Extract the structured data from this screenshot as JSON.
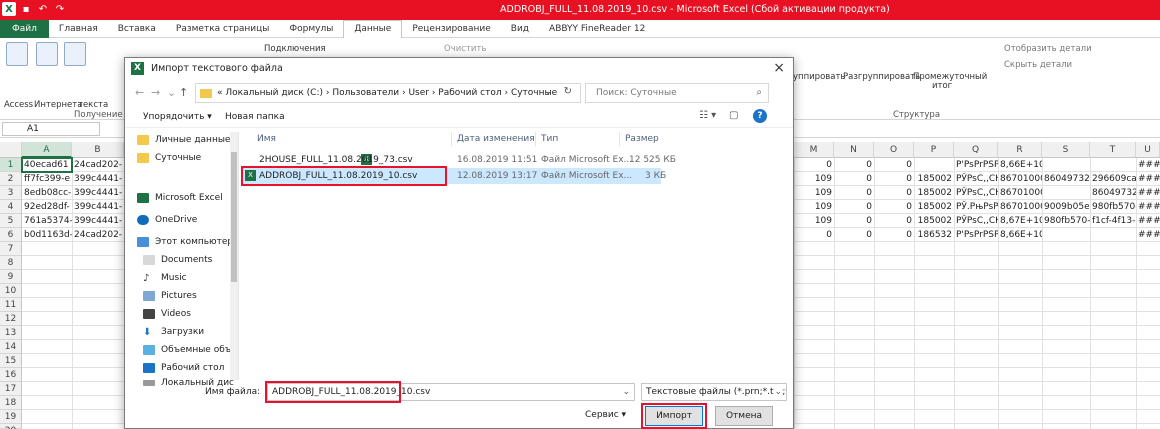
{
  "window": {
    "title": "ADDROBJ_FULL_11.08.2019_10.csv  -  Microsoft Excel (Сбой активации продукта)"
  },
  "ribbon": {
    "tabs": [
      {
        "label": "Файл"
      },
      {
        "label": "Главная"
      },
      {
        "label": "Вставка"
      },
      {
        "label": "Разметка страницы"
      },
      {
        "label": "Формулы"
      },
      {
        "label": "Данные"
      },
      {
        "label": "Рецензирование"
      },
      {
        "label": "Вид"
      },
      {
        "label": "ABBYY FineReader 12"
      }
    ],
    "connections_label": "Подключения",
    "clear_label": "Очистить",
    "access_label": "Access",
    "internet_label": "Интернета",
    "text_label": "текста",
    "get_external_label": "Получение вне",
    "group_label": "уппировать",
    "ungroup_label": "Разгруппировать",
    "subtotal_label": "Промежуточный",
    "subtotal_label2": "итог",
    "show_detail_label": "Отобразить детали",
    "hide_detail_label": "Скрыть детали",
    "structure_label": "Структура"
  },
  "namebox": {
    "value": "A1"
  },
  "grid": {
    "columns": [
      "A",
      "B",
      "M",
      "N",
      "O",
      "P",
      "Q",
      "R",
      "S",
      "T",
      "U"
    ],
    "rows": [
      "1",
      "2",
      "3",
      "4",
      "5",
      "6",
      "7",
      "8",
      "9",
      "10",
      "11",
      "12",
      "13",
      "14",
      "15",
      "16",
      "17",
      "18",
      "19",
      "20"
    ],
    "left_cells": [
      [
        "40ecad61",
        "24cad202- P'"
      ],
      [
        "ff7fc399-e",
        "399c4441- P"
      ],
      [
        "8edb08cc-",
        "399c4441- P"
      ],
      [
        "92ed28df-",
        "399c4441- P"
      ],
      [
        "761a5374-",
        "399c4441- P"
      ],
      [
        "b0d1163d-",
        "24cad202- P'"
      ]
    ],
    "right_cells": [
      [
        "0",
        "0",
        "0",
        "",
        "P'PsPrPSP",
        "8,66E+10",
        "",
        "",
        "#####"
      ],
      [
        "109",
        "0",
        "0",
        "185002",
        "PЎPsC,,CH",
        "86701000",
        "86049732-",
        "296609ca-",
        "#####"
      ],
      [
        "109",
        "0",
        "0",
        "185002",
        "PЎPsC,,CH",
        "86701000",
        "",
        "86049732-",
        "#####"
      ],
      [
        "109",
        "0",
        "0",
        "185002",
        "PЎ.PњPsP",
        "86701000",
        "9009b05e-",
        "980fb570-",
        "#####"
      ],
      [
        "109",
        "0",
        "0",
        "185002",
        "PЎPsC,,CH",
        "8,67E+10",
        "980fb570-",
        "f1cf-4f13-",
        "#####"
      ],
      [
        "0",
        "0",
        "0",
        "186532",
        "P'PsPrPSP",
        "8,66E+10",
        "",
        "",
        "#####"
      ]
    ]
  },
  "dialog": {
    "title": "Импорт текстового файла",
    "address_path": "«  Локальный диск (C:)  ›  Пользователи  ›  User  ›  Рабочий стол  ›  Суточные",
    "search_placeholder": "Поиск: Суточные",
    "organize_label": "Упорядочить ▾",
    "new_folder_label": "Новая папка",
    "nav_items": [
      {
        "label": "Личные данные",
        "icon": "folder-icon"
      },
      {
        "label": "Суточные",
        "icon": "folder-icon"
      },
      {
        "label": "Microsoft Excel",
        "icon": "excel-icon"
      },
      {
        "label": "OneDrive",
        "icon": "cloud-icon"
      },
      {
        "label": "Этот компьютер",
        "icon": "computer-icon"
      },
      {
        "label": "Documents",
        "icon": "documents-icon"
      },
      {
        "label": "Music",
        "icon": "music-icon"
      },
      {
        "label": "Pictures",
        "icon": "pictures-icon"
      },
      {
        "label": "Videos",
        "icon": "videos-icon"
      },
      {
        "label": "Загрузки",
        "icon": "downloads-icon"
      },
      {
        "label": "Объемные объ",
        "icon": "3d-objects-icon"
      },
      {
        "label": "Рабочий стол",
        "icon": "desktop-icon"
      },
      {
        "label": "Локальный дис",
        "icon": "drive-icon"
      }
    ],
    "columns": [
      "Имя",
      "Дата изменения",
      "Тип",
      "Размер"
    ],
    "files": [
      {
        "name": "2HOUSE_FULL_11.08.2019_73.csv",
        "date": "16.08.2019 11:51",
        "type": "Файл Microsoft Ex...",
        "size": "12 525 КБ",
        "selected": false
      },
      {
        "name": "ADDROBJ_FULL_11.08.2019_10.csv",
        "date": "12.08.2019 13:17",
        "type": "Файл Microsoft Ex...",
        "size": "3 КБ",
        "selected": true
      }
    ],
    "filename_label": "Имя файла:",
    "filename_value": "ADDROBJ_FULL_11.08.2019_10.csv",
    "filetype_value": "Текстовые файлы (*.prn;*.txt;*",
    "tools_label": "Сервис  ▾",
    "import_label": "Импорт",
    "cancel_label": "Отмена"
  }
}
